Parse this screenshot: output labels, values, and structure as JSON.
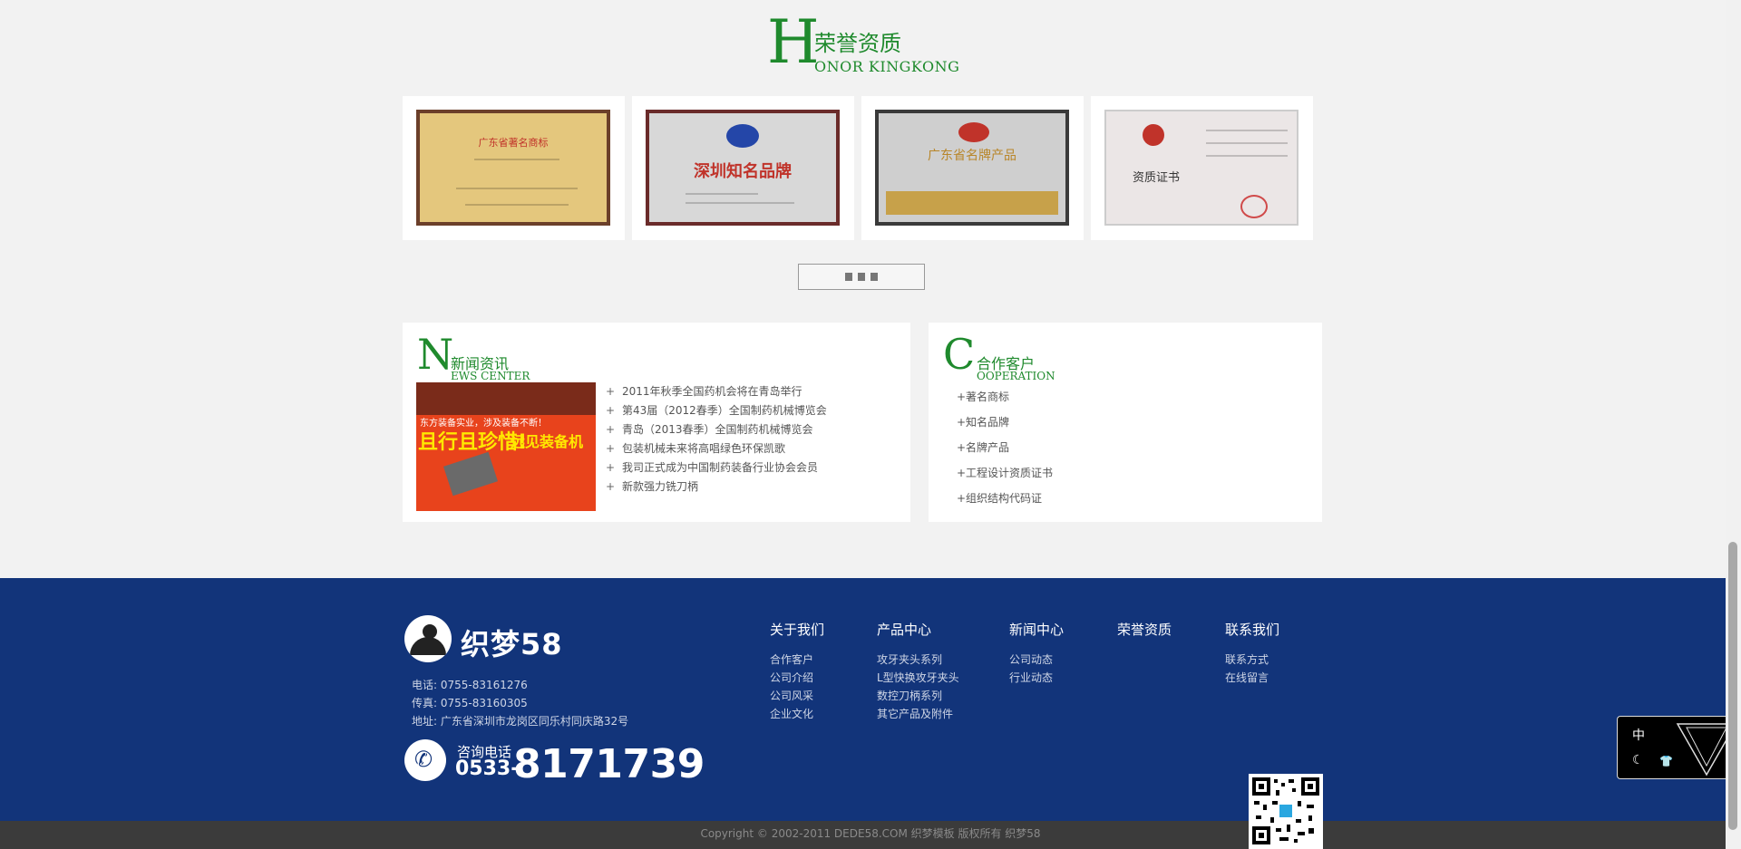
{
  "honor": {
    "big_letter": "H",
    "title_cn": "荣誉资质",
    "title_en": "ONOR KINGKONG"
  },
  "certificates": [
    {
      "title": "广东省著名商标"
    },
    {
      "title": "深圳知名品牌"
    },
    {
      "title": "广东省名牌产品"
    },
    {
      "title": "资质证书"
    }
  ],
  "news": {
    "big_letter": "N",
    "title_cn": "新闻资讯",
    "title_en": "EWS CENTER",
    "image_text_main": "且行且珍惜!",
    "image_text_side": "远见装备机",
    "image_text_sub": "东方装备实业，涉及装备不断！",
    "plus": "+",
    "items": [
      "2011年秋季全国药机会将在青岛举行",
      "第43届（2012春季）全国制药机械博览会",
      "青岛（2013春季）全国制药机械博览会",
      "包装机械未来将高唱绿色环保凯歌",
      "我司正式成为中国制药装备行业协会会员",
      "新款强力铣刀柄"
    ]
  },
  "cooperation": {
    "big_letter": "C",
    "title_cn": "合作客户",
    "title_en": "OOPERATION",
    "items": [
      "+著名商标",
      "+知名品牌",
      "+名牌产品",
      "+工程设计资质证书",
      "+组织结构代码证"
    ]
  },
  "footer": {
    "logo_text": "织梦58",
    "phone": "电话: 0755-83161276",
    "fax": "传真: 0755-83160305",
    "address": "地址: 广东省深圳市龙岗区同乐村同庆路32号",
    "hotline_label": "咨询电话",
    "hotline_prefix": "0533-",
    "hotline_number": "8171739",
    "columns": [
      {
        "head": "关于我们",
        "items": [
          "合作客户",
          "公司介绍",
          "公司风采",
          "企业文化"
        ]
      },
      {
        "head": "产品中心",
        "items": [
          "攻牙夹头系列",
          "L型快换攻牙夹头",
          "数控刀柄系列",
          "其它产品及附件"
        ]
      },
      {
        "head": "新闻中心",
        "items": [
          "公司动态",
          "行业动态"
        ]
      },
      {
        "head": "荣誉资质",
        "items": []
      },
      {
        "head": "联系我们",
        "items": [
          "联系方式",
          "在线留言"
        ]
      }
    ],
    "copyright": "Copyright © 2002-2011 DEDE58.COM 织梦模板 版权所有   织梦58"
  },
  "float_widget": {
    "lang": "中",
    "moon_icon": "moon-icon",
    "shirt_icon": "shirt-icon"
  },
  "colors": {
    "brand_green": "#1f8a2d",
    "footer_blue": "#12347a",
    "copyright_bar": "#3b3b3b"
  }
}
